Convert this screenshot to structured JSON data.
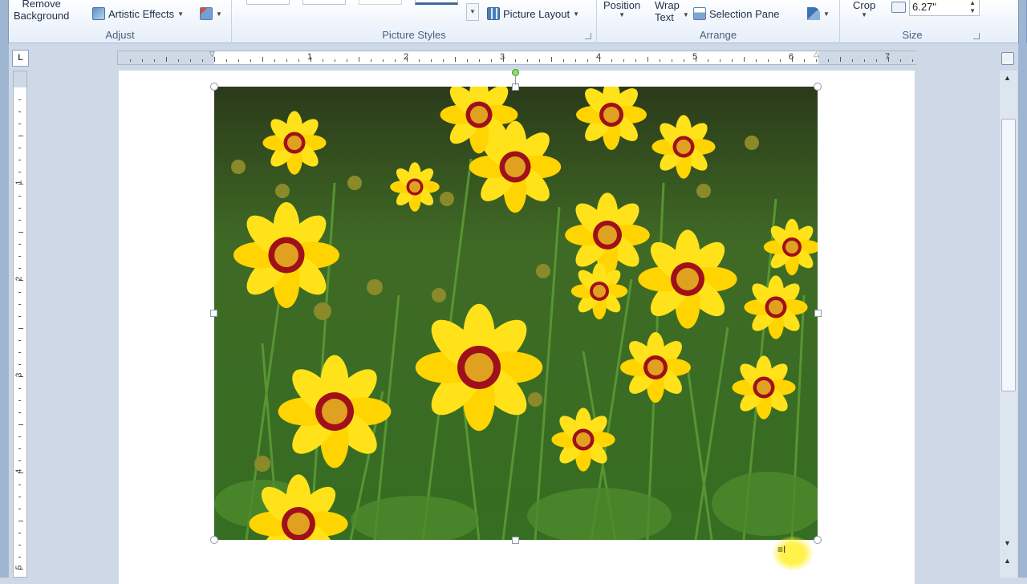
{
  "ribbon": {
    "adjust": {
      "remove_background": "Remove\nBackground",
      "artistic_effects": "Artistic Effects",
      "group_label": "Adjust"
    },
    "picture_styles": {
      "picture_layout": "Picture Layout",
      "group_label": "Picture Styles"
    },
    "arrange": {
      "position": "Position",
      "wrap_text": "Wrap\nText",
      "selection_pane": "Selection Pane",
      "group_label": "Arrange"
    },
    "size": {
      "crop": "Crop",
      "width_value": "6.27\"",
      "group_label": "Size"
    }
  },
  "ruler": {
    "corner_tab": "L",
    "numbers": [
      "1",
      "2",
      "3",
      "4",
      "5",
      "6",
      "7"
    ],
    "vertical_numbers": [
      "1",
      "2",
      "3",
      "4",
      "5"
    ]
  },
  "colors": {
    "ribbon_bg": "#e6eef9",
    "accent": "#9fb6d3",
    "flower_yellow": "#ffe21a",
    "flower_center": "#a0101a",
    "foliage": "#3f7a2a"
  }
}
